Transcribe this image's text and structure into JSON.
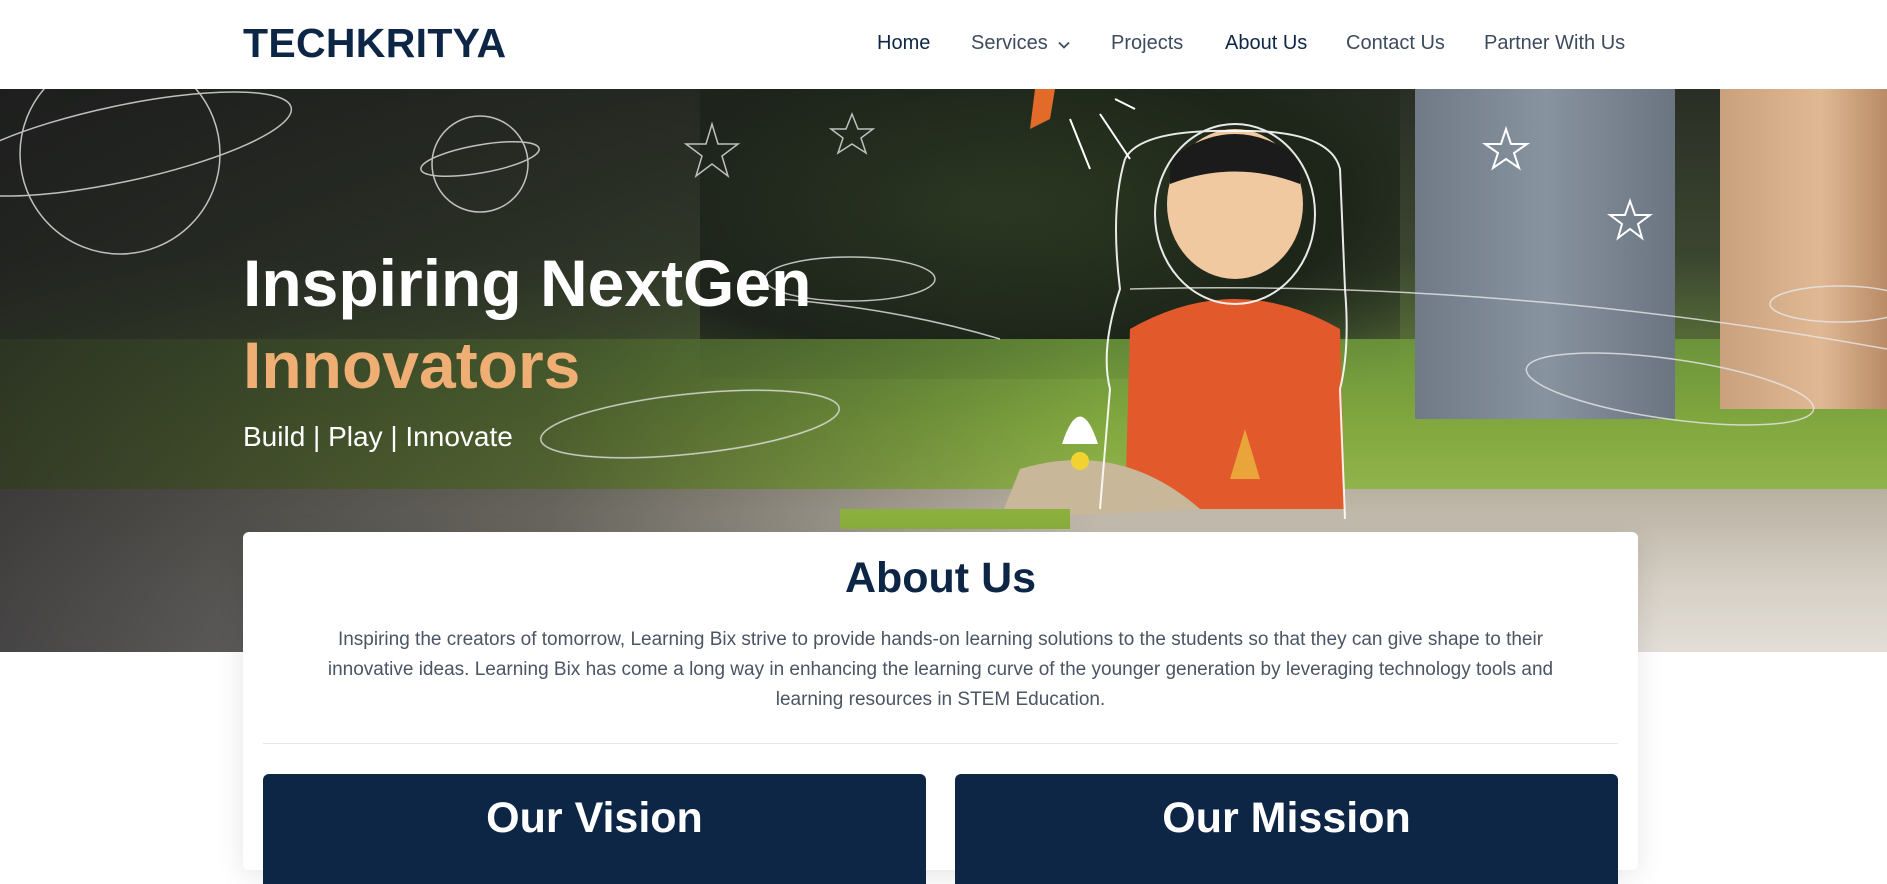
{
  "header": {
    "logo": "TECHKRITYA",
    "nav": [
      {
        "label": "Home"
      },
      {
        "label": "Services"
      },
      {
        "label": "Projects"
      },
      {
        "label": "About Us"
      },
      {
        "label": "Contact Us"
      },
      {
        "label": "Partner With Us"
      }
    ]
  },
  "hero": {
    "title_line1": "Inspiring NextGen",
    "title_line2": "Innovators",
    "tagline": "Build | Play | Innovate"
  },
  "about": {
    "title": "About Us",
    "text": "Inspiring the creators of tomorrow, Learning Bix strive to provide hands-on learning solutions to the students so that they can give shape to their innovative ideas. Learning Bix has come a long way in enhancing the learning curve of the younger generation by leveraging technology tools and learning resources in STEM Education.",
    "vision_title": "Our Vision",
    "mission_title": "Our Mission"
  },
  "colors": {
    "brand_navy": "#0d2646",
    "accent_orange": "#efae74"
  },
  "icons": {
    "services_dropdown": "chevron-down-icon"
  }
}
